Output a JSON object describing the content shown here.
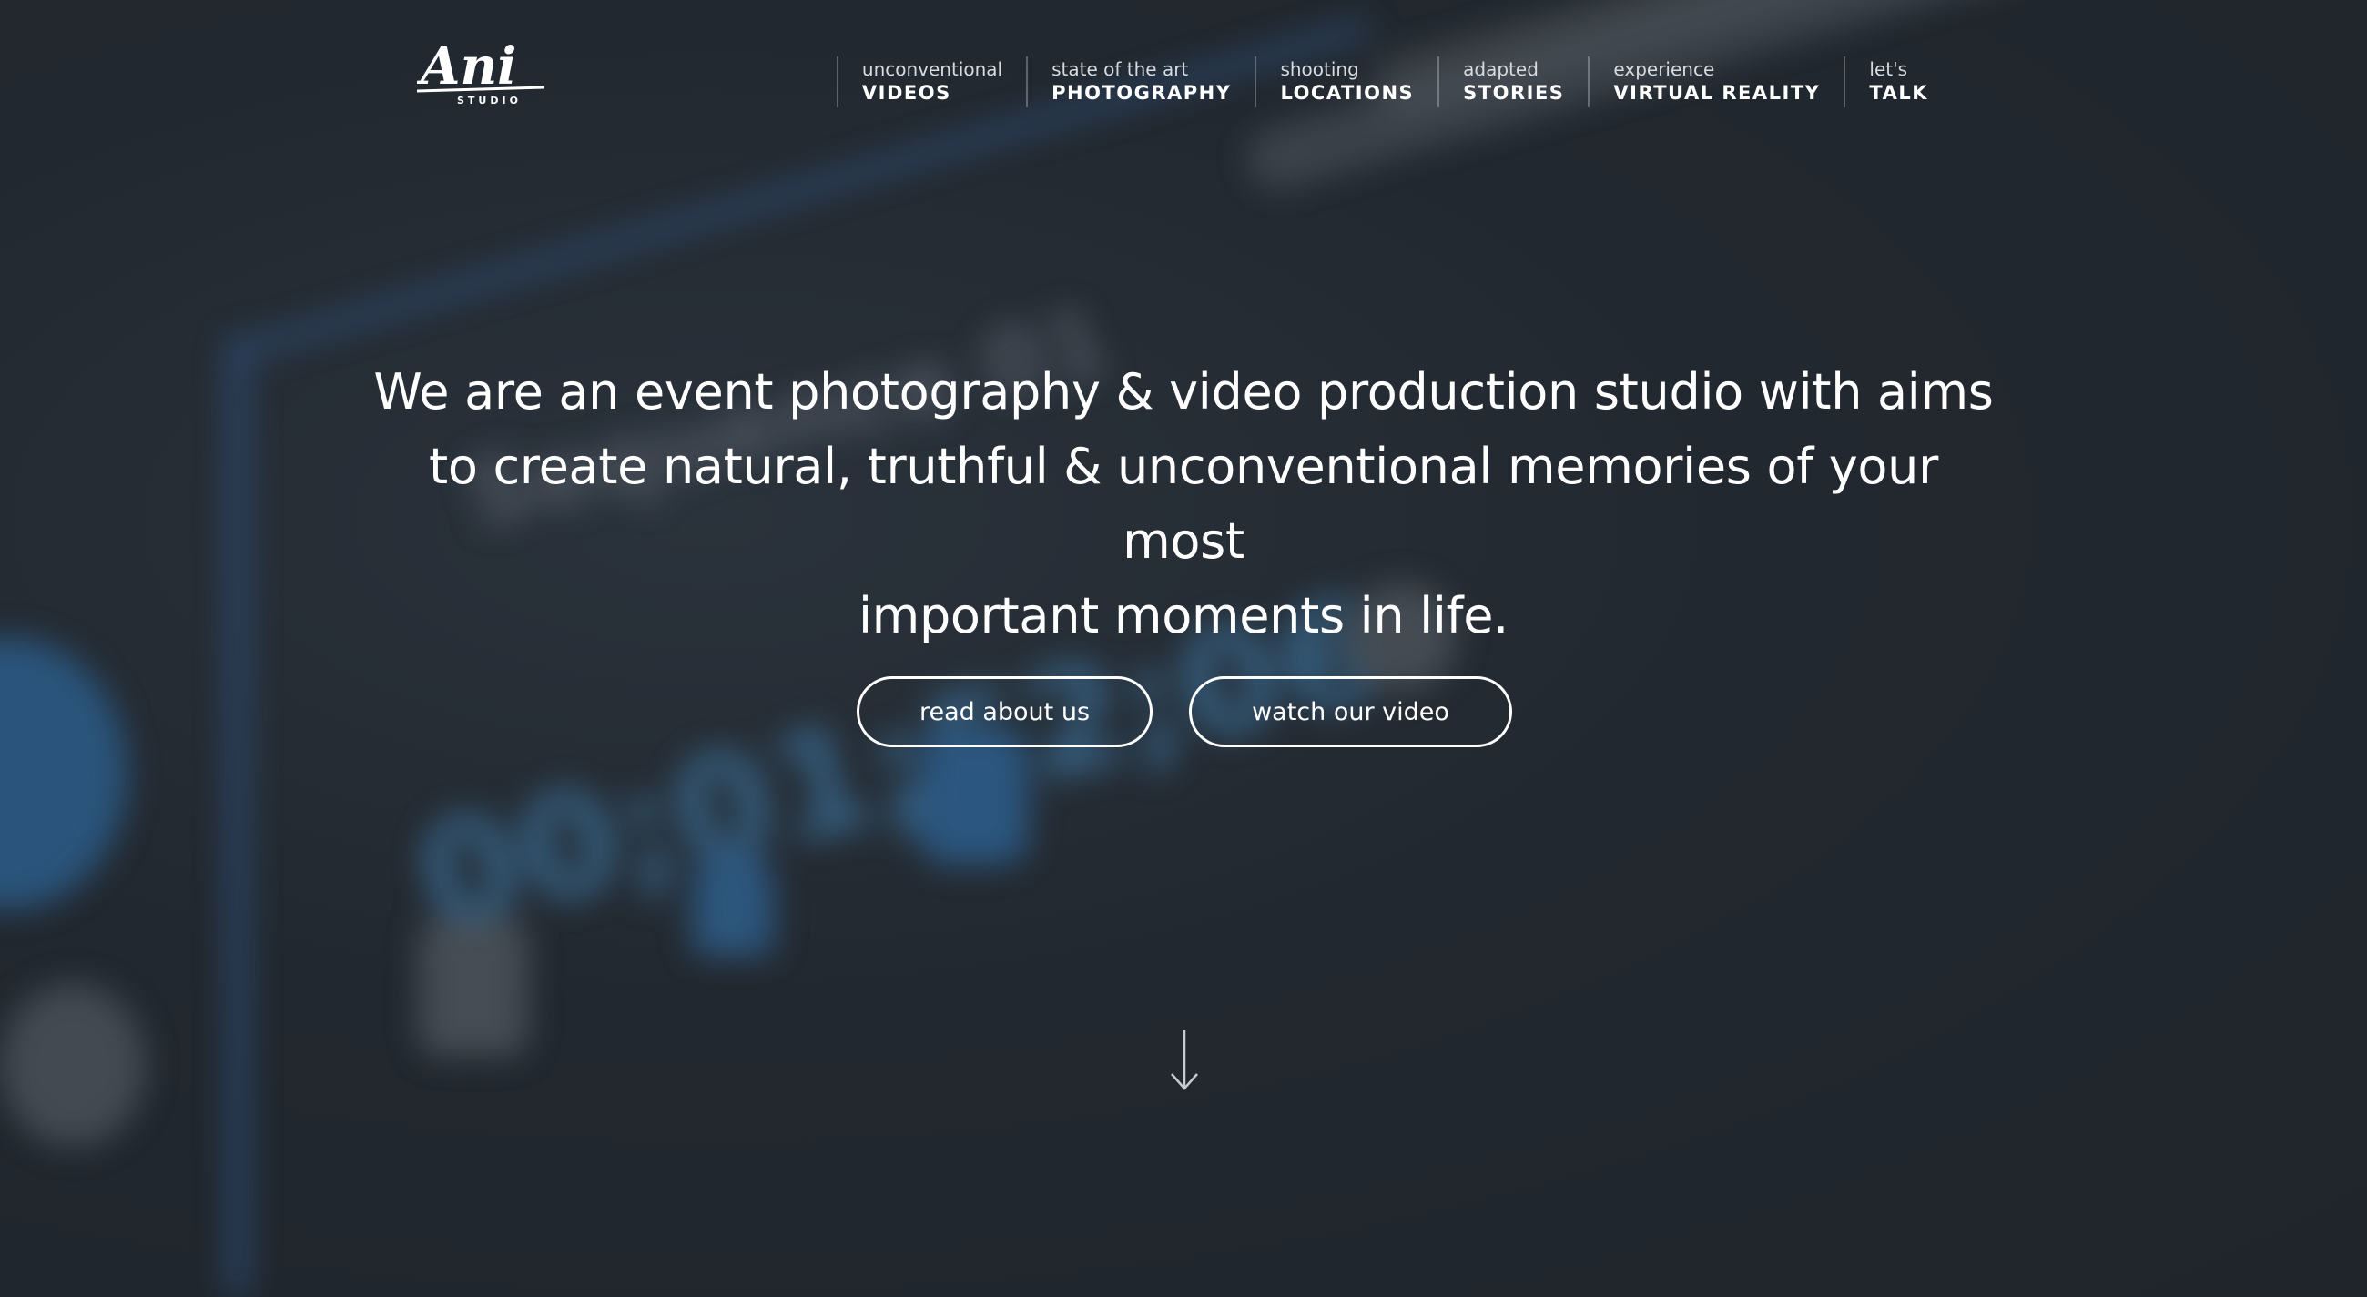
{
  "brand": {
    "logo_text": "Ani",
    "logo_subtext": "STUDIO"
  },
  "nav": {
    "items": [
      {
        "top": "unconventional",
        "bottom": "VIDEOS"
      },
      {
        "top": "state of the art",
        "bottom": "PHOTOGRAPHY"
      },
      {
        "top": "shooting",
        "bottom": "LOCATIONS"
      },
      {
        "top": "adapted",
        "bottom": "STORIES"
      },
      {
        "top": "experience",
        "bottom": "VIRTUAL REALITY"
      },
      {
        "top": "let's",
        "bottom": "TALK"
      }
    ]
  },
  "hero": {
    "line1": "We are an event photography & video production studio with aims",
    "line2": "to create natural, truthful & unconventional memories of your most",
    "line3": "important moments in life."
  },
  "buttons": {
    "about_label": "read about us",
    "video_label": "watch our video"
  },
  "background": {
    "sequence_text": "Sequence 01",
    "timecode_text": "00;01;52;06"
  },
  "icons": {
    "scroll": "arrow-down-icon"
  },
  "colors": {
    "background": "#21272e",
    "accent_blue": "#3b6e96",
    "text": "#ffffff"
  }
}
